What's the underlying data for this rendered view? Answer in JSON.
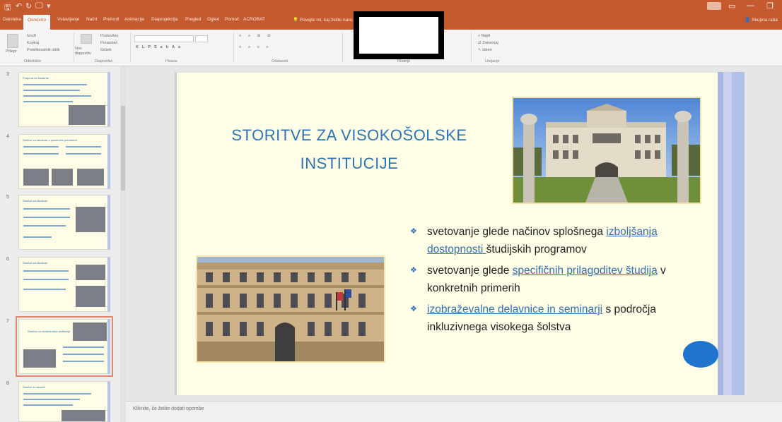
{
  "titlebar": {
    "quick_access": [
      "🖫",
      "↶",
      "↻",
      "🖵",
      "▾"
    ],
    "account_badge": "",
    "window_controls": [
      "—",
      "□",
      "✕"
    ]
  },
  "tabs": {
    "items": [
      "Datoteka",
      "Osnovno",
      "Vstavljanje",
      "Načrt",
      "Prehodi",
      "Animacije",
      "Diaprojekcija",
      "Pregled",
      "Ogled",
      "Pomoč",
      "ACROBAT"
    ],
    "active_index": 1,
    "search_label": "Povejte mi, kaj želite nare...",
    "share_label": "Skupna raba"
  },
  "ribbon": {
    "groups": [
      "Odložišče",
      "Diapozitivi",
      "Pisava",
      "Odstavek",
      "Risanje",
      "Urejanje"
    ],
    "paste": "Prilepi",
    "cut": "Izreži",
    "copy": "Kopiraj",
    "format_painter": "Preslikovalnik oblik",
    "new_slide": "Nov diapozitiv",
    "layout": "Postavitev",
    "reset": "Ponastavi",
    "section": "Odsek",
    "find": "Najdi",
    "replace": "Zamenjaj",
    "select": "Izberi"
  },
  "thumbnails": [
    {
      "num": "3",
      "title": "Podpora za študente"
    },
    {
      "num": "4",
      "title": "Storitve za študente s posebnimi potrebami"
    },
    {
      "num": "5",
      "title": "Storitve za študente"
    },
    {
      "num": "6",
      "title": "Storitve za študente"
    },
    {
      "num": "7",
      "title": "Storitve za visokošolske institucije"
    },
    {
      "num": "8",
      "title": "Storitve in nasveti"
    }
  ],
  "selected_thumbnail": 4,
  "slide": {
    "title": "STORITVE ZA VISOKOŠOLSKE INSTITUCIJE",
    "bullet_char": "❖",
    "bullets": [
      {
        "pre": "svetovanje glede načinov splošnega ",
        "link": "izboljšanja dostopnosti ",
        "post": "študijskih programov"
      },
      {
        "pre": "svetovanje glede ",
        "link": "specifičnih prilagoditev študija",
        "post": " v konkretnih primerih"
      },
      {
        "pre": "",
        "link": "izobraževalne delavnice in seminarji",
        "post": " s področja inkluzivnega visokega šolstva"
      }
    ],
    "accent_color": "#2e74b5",
    "oval_color": "#1f74d0"
  },
  "notes_placeholder": "Kliknite, če želite dodati opombe"
}
